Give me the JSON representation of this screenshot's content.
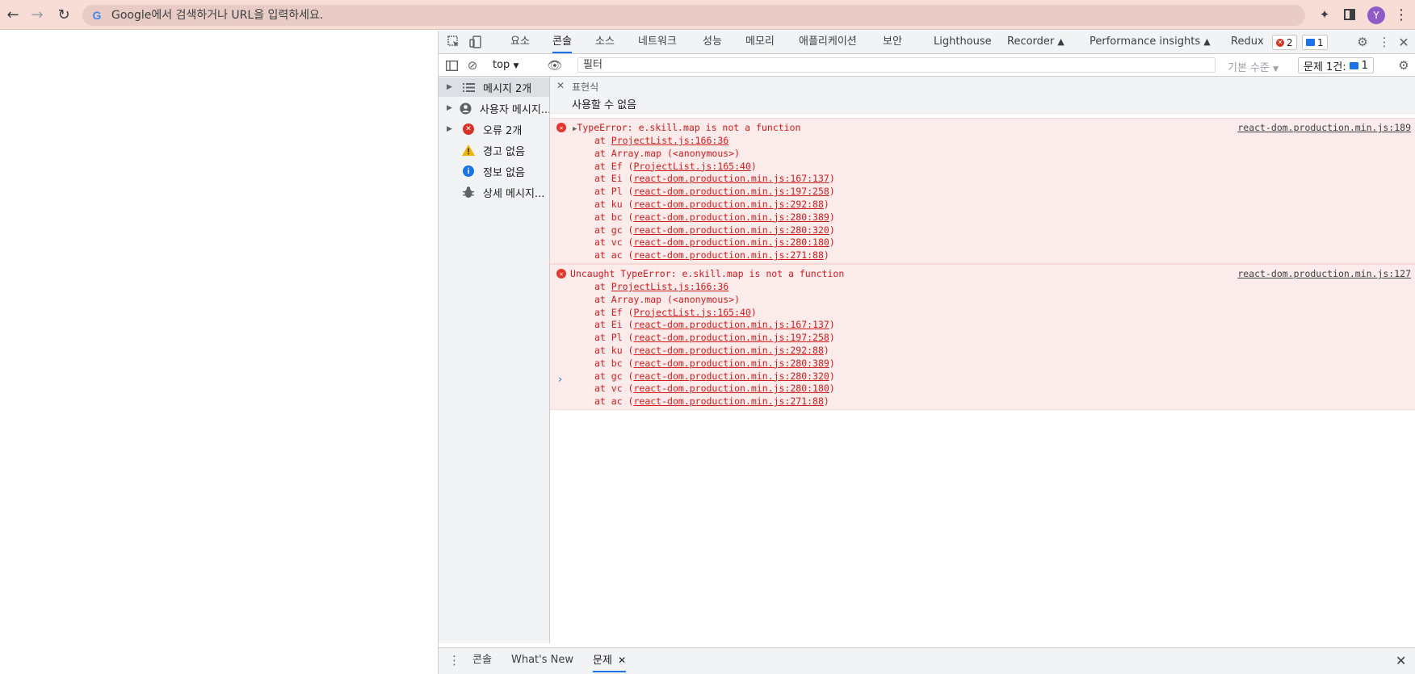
{
  "browser": {
    "omnibox_placeholder": "Google에서 검색하거나 URL을 입력하세요.",
    "avatar_letter": "Y",
    "accent": "#f7ddd6"
  },
  "devtools": {
    "tabs": [
      "요소",
      "콘솔",
      "소스",
      "네트워크",
      "성능",
      "메모리",
      "애플리케이션",
      "보안",
      "Lighthouse",
      "Recorder",
      "Performance insights",
      "Redux"
    ],
    "active_tab": "콘솔",
    "error_badge_count": "2",
    "message_badge_count": "1",
    "console_bar": {
      "context": "top",
      "filter_placeholder": "필터",
      "levels": "기본 수준",
      "issues_label": "문제 1건:",
      "issues_count": "1"
    },
    "sidebar": [
      {
        "label": "메시지 2개",
        "icon": "list-icon",
        "expandable": true
      },
      {
        "label": "사용자 메시지...",
        "icon": "user-icon",
        "expandable": true
      },
      {
        "label": "오류 2개",
        "icon": "error-icon",
        "expandable": true
      },
      {
        "label": "경고 없음",
        "icon": "warning-icon",
        "expandable": false
      },
      {
        "label": "정보 없음",
        "icon": "info-icon",
        "expandable": false
      },
      {
        "label": "상세 메시지...",
        "icon": "bug-icon",
        "expandable": false
      }
    ],
    "expression": {
      "title": "표현식",
      "value": "사용할 수 없음"
    },
    "errors": [
      {
        "message": "TypeError: e.skill.map is not a function",
        "source": "react-dom.production.min.js:189",
        "stack": [
          {
            "fn": "at ",
            "link": "ProjectList.js:166:36",
            "paren": false
          },
          {
            "fn": "at Array.map (<anonymous>)",
            "link": "",
            "paren": false
          },
          {
            "fn": "at Ef ",
            "link": "ProjectList.js:165:40",
            "paren": true
          },
          {
            "fn": "at Ei ",
            "link": "react-dom.production.min.js:167:137",
            "paren": true
          },
          {
            "fn": "at Pl ",
            "link": "react-dom.production.min.js:197:258",
            "paren": true
          },
          {
            "fn": "at ku ",
            "link": "react-dom.production.min.js:292:88",
            "paren": true
          },
          {
            "fn": "at bc ",
            "link": "react-dom.production.min.js:280:389",
            "paren": true
          },
          {
            "fn": "at gc ",
            "link": "react-dom.production.min.js:280:320",
            "paren": true
          },
          {
            "fn": "at vc ",
            "link": "react-dom.production.min.js:280:180",
            "paren": true
          },
          {
            "fn": "at ac ",
            "link": "react-dom.production.min.js:271:88",
            "paren": true
          }
        ]
      },
      {
        "message": "Uncaught TypeError: e.skill.map is not a function",
        "source": "react-dom.production.min.js:127",
        "stack": [
          {
            "fn": "at ",
            "link": "ProjectList.js:166:36",
            "paren": false
          },
          {
            "fn": "at Array.map (<anonymous>)",
            "link": "",
            "paren": false
          },
          {
            "fn": "at Ef ",
            "link": "ProjectList.js:165:40",
            "paren": true
          },
          {
            "fn": "at Ei ",
            "link": "react-dom.production.min.js:167:137",
            "paren": true
          },
          {
            "fn": "at Pl ",
            "link": "react-dom.production.min.js:197:258",
            "paren": true
          },
          {
            "fn": "at ku ",
            "link": "react-dom.production.min.js:292:88",
            "paren": true
          },
          {
            "fn": "at bc ",
            "link": "react-dom.production.min.js:280:389",
            "paren": true
          },
          {
            "fn": "at gc ",
            "link": "react-dom.production.min.js:280:320",
            "paren": true
          },
          {
            "fn": "at vc ",
            "link": "react-dom.production.min.js:280:180",
            "paren": true
          },
          {
            "fn": "at ac ",
            "link": "react-dom.production.min.js:271:88",
            "paren": true
          }
        ]
      }
    ],
    "drawer_tabs": [
      "콘솔",
      "What's New",
      "문제"
    ],
    "drawer_active": "문제"
  }
}
